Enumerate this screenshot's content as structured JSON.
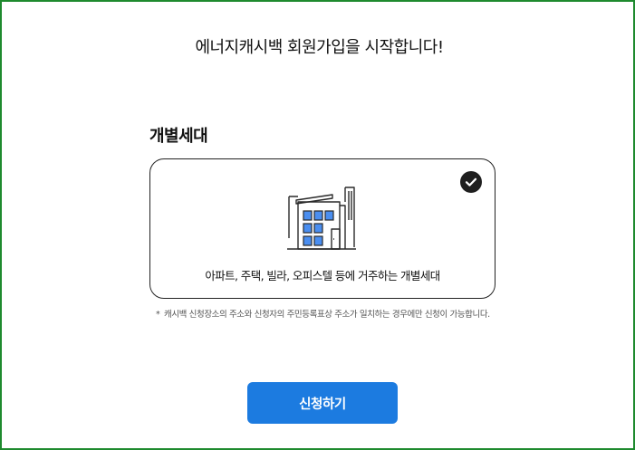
{
  "header": {
    "title": "에너지캐시백 회원가입을 시작합니다!"
  },
  "section": {
    "heading": "개별세대"
  },
  "option_card": {
    "selected": true,
    "icon": "building-icon",
    "check_icon": "check-circle-icon",
    "label": "아파트, 주택, 빌라, 오피스텔 등에 거주하는 개별세대"
  },
  "notice": {
    "bullet": "*",
    "text": "캐시백 신청장소의 주소와 신청자의 주민등록표상 주소가 일치하는 경우에만 신청이 가능합니다."
  },
  "actions": {
    "apply_label": "신청하기"
  },
  "colors": {
    "frame_border": "#1e8a2e",
    "button": "#1c7be0",
    "window_fill": "#4a8ef0",
    "card_border": "#222222"
  }
}
